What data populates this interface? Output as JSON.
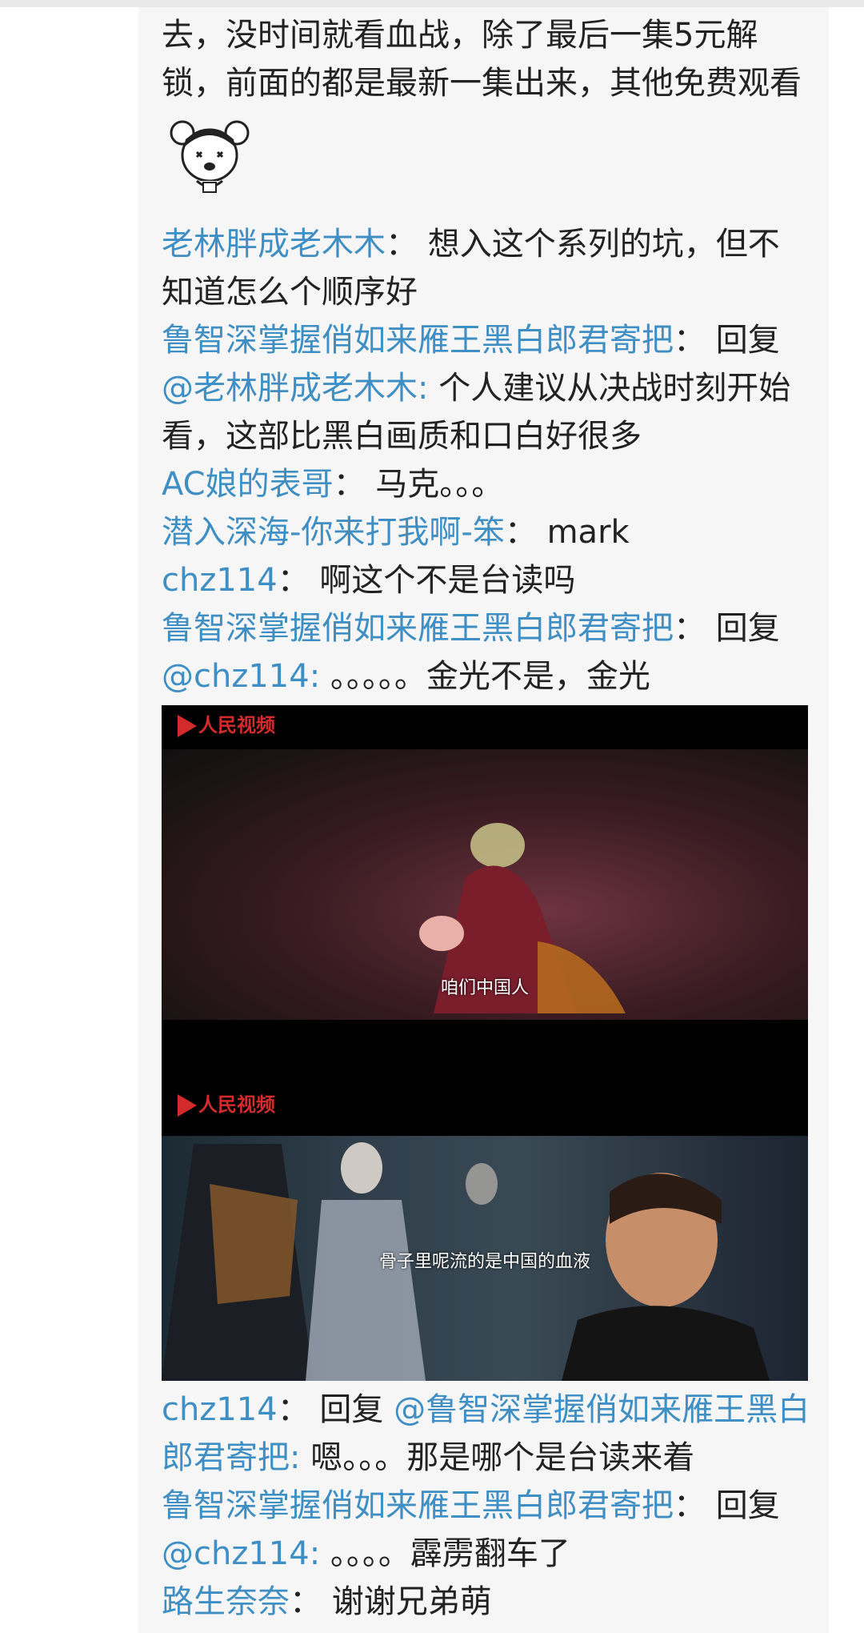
{
  "thread": {
    "lines": [
      [
        {
          "t": "去，没时间就看血战，除了最后一集5元解",
          "k": "text"
        }
      ],
      [
        {
          "t": "锁，前面的都是最新一集出来，其他免费观看",
          "k": "text"
        }
      ],
      "STICKER",
      [
        {
          "t": "老林胖成老木木",
          "k": "user"
        },
        {
          "t": "： 想入这个系列的坑，但不",
          "k": "text"
        }
      ],
      [
        {
          "t": "知道怎么个顺序好",
          "k": "text"
        }
      ],
      [
        {
          "t": "鲁智深掌握俏如来雁王黑白郎君寄把",
          "k": "user"
        },
        {
          "t": "： 回复",
          "k": "text"
        }
      ],
      [
        {
          "t": "@老林胖成老木木:",
          "k": "mention"
        },
        {
          "t": " 个人建议从决战时刻开始",
          "k": "text"
        }
      ],
      [
        {
          "t": "看，这部比黑白画质和口白好很多",
          "k": "text"
        }
      ],
      [
        {
          "t": "AC娘的表哥",
          "k": "user"
        },
        {
          "t": "： 马克。。。",
          "k": "text"
        }
      ],
      [
        {
          "t": "潜入深海-你来打我啊-笨",
          "k": "user"
        },
        {
          "t": "： mark",
          "k": "text"
        }
      ],
      [
        {
          "t": "chz114",
          "k": "user"
        },
        {
          "t": "： 啊这个不是台读吗",
          "k": "text"
        }
      ],
      [
        {
          "t": "鲁智深掌握俏如来雁王黑白郎君寄把",
          "k": "user"
        },
        {
          "t": "： 回复",
          "k": "text"
        }
      ],
      [
        {
          "t": "@chz114:",
          "k": "mention"
        },
        {
          "t": " 。。。。。金光不是，金光",
          "k": "text"
        }
      ],
      "IMAGE",
      [
        {
          "t": "chz114",
          "k": "user"
        },
        {
          "t": "： 回复 ",
          "k": "text"
        },
        {
          "t": "@鲁智深掌握俏如来雁王黑白",
          "k": "mention"
        }
      ],
      [
        {
          "t": "郎君寄把:",
          "k": "mention"
        },
        {
          "t": " 嗯。。。那是哪个是台读来着",
          "k": "text"
        }
      ],
      [
        {
          "t": "鲁智深掌握俏如来雁王黑白郎君寄把",
          "k": "user"
        },
        {
          "t": "： 回复",
          "k": "text"
        }
      ],
      [
        {
          "t": "@chz114:",
          "k": "mention"
        },
        {
          "t": " 。。。。霹雳翻车了",
          "k": "text"
        }
      ],
      [
        {
          "t": "路生奈奈",
          "k": "user"
        },
        {
          "t": "： 谢谢兄弟萌",
          "k": "text"
        }
      ]
    ]
  },
  "image": {
    "logo_text": "人民视频",
    "frames": [
      {
        "subtitle": "咱们中国人"
      },
      {
        "subtitle": "骨子里呢流的是中国的血液"
      }
    ]
  },
  "colors": {
    "username": "#3f8fc4",
    "text": "#222222",
    "panel": "#f6f6f6"
  }
}
